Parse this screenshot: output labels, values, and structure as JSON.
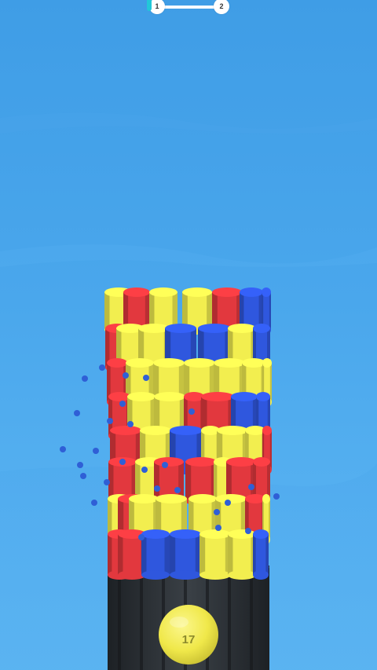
{
  "level": {
    "current": "1",
    "next": "2",
    "progress": 0
  },
  "ball": {
    "count": "17",
    "color": "#f3ec4c"
  },
  "colors": {
    "sky_top": "#3f9de6",
    "sky_bottom": "#5bb4f1",
    "red": "#e2383e",
    "yellow": "#f2ee4f",
    "blue": "#2f57de",
    "base": "#2b3035",
    "particle": "#2f5fd6"
  },
  "icons": {
    "ball": "yellow-ball-icon"
  }
}
